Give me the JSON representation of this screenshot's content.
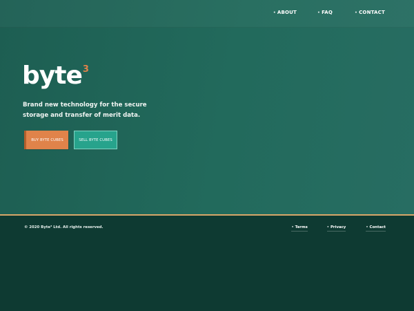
{
  "nav": {
    "items": [
      {
        "label": "ABOUT"
      },
      {
        "label": "FAQ"
      },
      {
        "label": "CONTACT"
      }
    ],
    "bullet": "•"
  },
  "hero": {
    "logo_text": "byte",
    "logo_superscript": "3",
    "tagline": "Brand new technology for the secure storage and transfer of merit data.",
    "buy_label": "BUY BYTE CUBES",
    "sell_label": "SELL BYTE CUBES"
  },
  "footer": {
    "copyright": "© 2020 Byte³ Ltd. All rights reserved.",
    "links": [
      {
        "label": "Terms"
      },
      {
        "label": "Privacy"
      },
      {
        "label": "Contact"
      }
    ],
    "bullet": "•"
  },
  "colors": {
    "hero_bg": "#226a5c",
    "footer_bg": "#0e3a32",
    "accent_orange": "#e0834a",
    "accent_teal": "#27a38c",
    "divider_gold": "#d9a769"
  }
}
